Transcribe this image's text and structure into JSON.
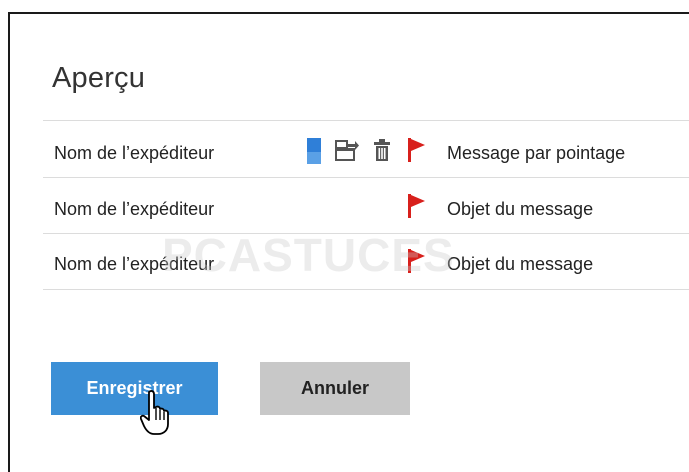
{
  "preview": {
    "title": "Aperçu",
    "rows": [
      {
        "sender": "Nom de l’expéditeur",
        "subject": "Message par pointage"
      },
      {
        "sender": "Nom de l’expéditeur",
        "subject": "Objet du message"
      },
      {
        "sender": "Nom de l’expéditeur",
        "subject": "Objet du message"
      }
    ]
  },
  "buttons": {
    "save": "Enregistrer",
    "cancel": "Annuler"
  },
  "watermark": "PCASTUCES",
  "icons": [
    "marker-icon",
    "move-to-folder-icon",
    "trash-icon",
    "flag-icon",
    "hand-cursor-icon"
  ],
  "colors": {
    "accent": "#3b8fd6",
    "flag": "#d8201c",
    "marker": "#2f7fd8",
    "cancel_bg": "#c8c8c8"
  }
}
